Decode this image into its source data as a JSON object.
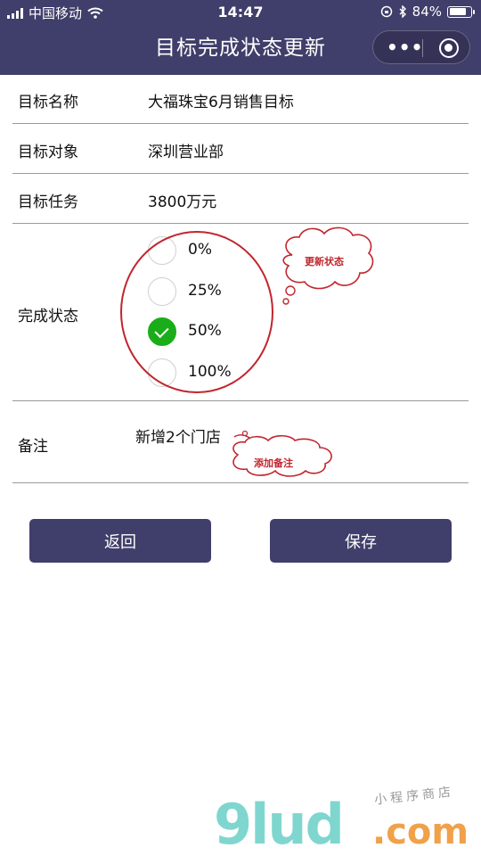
{
  "status_bar": {
    "carrier": "中国移动",
    "time": "14:47",
    "battery_text": "84%",
    "battery_level": 0.84
  },
  "nav": {
    "title": "目标完成状态更新",
    "menu_icon": "more-dots-icon",
    "close_icon": "target-close-icon"
  },
  "form": {
    "name": {
      "label": "目标名称",
      "value": "大福珠宝6月销售目标"
    },
    "object": {
      "label": "目标对象",
      "value": "深圳营业部"
    },
    "task": {
      "label": "目标任务",
      "value": "3800万元"
    },
    "status": {
      "label": "完成状态",
      "options": [
        "0%",
        "25%",
        "50%",
        "100%"
      ],
      "selected": "50%"
    },
    "remark": {
      "label": "备注",
      "value": "新增2个门店"
    }
  },
  "buttons": {
    "back": "返回",
    "save": "保存"
  },
  "annotations": {
    "update_status": "更新状态",
    "add_remark": "添加备注"
  },
  "watermark": {
    "logo": "9lud",
    "domain": ".com",
    "tagline": "小程序商店"
  },
  "colors": {
    "nav_bg": "#403e6a",
    "button_bg": "#403e6a",
    "radio_checked": "#1aad19",
    "annotation_red": "#c0262d"
  }
}
